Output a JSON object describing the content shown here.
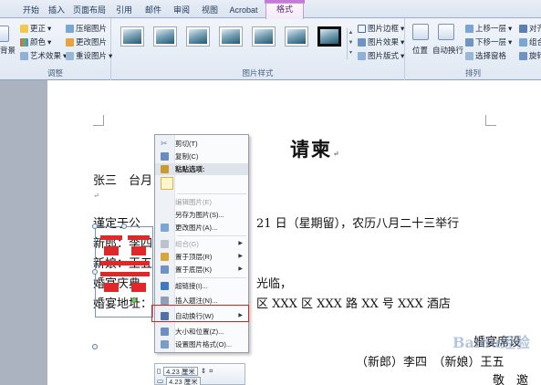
{
  "ribbon": {
    "tabs": [
      {
        "label": "开始",
        "active": false
      },
      {
        "label": "插入",
        "active": false
      },
      {
        "label": "页面布局",
        "active": false
      },
      {
        "label": "引用",
        "active": false
      },
      {
        "label": "邮件",
        "active": false
      },
      {
        "label": "审阅",
        "active": false
      },
      {
        "label": "视图",
        "active": false
      },
      {
        "label": "Acrobat",
        "active": false
      },
      {
        "label": "格式",
        "active": true
      }
    ],
    "adjust": {
      "title": "调整",
      "left_clip_label": "背景",
      "correct": "更正",
      "color": "颜色",
      "artistic": "艺术效果",
      "compress": "压缩图片",
      "change": "更改图片",
      "reset": "重设图片"
    },
    "picture_styles": {
      "title": "图片样式",
      "border": "图片边框",
      "effects": "图片效果",
      "layout": "图片版式"
    },
    "arrange": {
      "title": "排列",
      "position": "位置",
      "wrap": "自动换行",
      "bring_forward": "上移一层",
      "send_backward": "下移一层",
      "selection_pane": "选择窗格",
      "align": "对齐",
      "group": "组合",
      "rotate": "旋转"
    }
  },
  "document": {
    "title": "请柬",
    "line1": "张三　台月",
    "line2a": "谨定于公",
    "line2b": "21 日（星期留），农历八月二十三举行",
    "line3": "新郎：李四",
    "line4": "新娘：王五",
    "line5a": "婚宴庆典",
    "line5b": "光临，",
    "line6a": "婚宴地址：",
    "line6b": "区 XXX 区 XXX 路 XX 号 XXX 酒店",
    "right1": "婚宴席设",
    "right2": "（新郎）李四　（新娘）王五",
    "right3": "敬　邀",
    "watermark": "Baidu经验"
  },
  "context_menu": {
    "items": [
      {
        "label": "剪切(T)",
        "disabled": false,
        "arrow": false,
        "icon_color": "#5b7fb3"
      },
      {
        "label": "复制(C)",
        "disabled": false,
        "arrow": false,
        "icon_color": "#6a8cc0"
      },
      {
        "label": "粘贴选项:",
        "disabled": false,
        "arrow": false,
        "header": true,
        "icon_color": "#c99b2c"
      },
      {
        "label": "",
        "disabled": false,
        "arrow": false,
        "spacer": true
      },
      {
        "label": "编辑图片(E)",
        "disabled": true,
        "arrow": false
      },
      {
        "label": "另存为图片(S)...",
        "disabled": false,
        "arrow": false
      },
      {
        "label": "更改图片(A)...",
        "disabled": false,
        "arrow": false,
        "icon_color": "#7aa6d6"
      },
      {
        "label": "组合(G)",
        "disabled": true,
        "arrow": true,
        "icon_color": "#b9c2ce"
      },
      {
        "label": "置于顶层(R)",
        "disabled": false,
        "arrow": true,
        "icon_color": "#d8a53a"
      },
      {
        "label": "置于底层(K)",
        "disabled": false,
        "arrow": true,
        "icon_color": "#6f93c4"
      },
      {
        "label": "超链接(I)...",
        "disabled": false,
        "arrow": false,
        "icon_color": "#3e79c2"
      },
      {
        "label": "插入题注(N)...",
        "disabled": false,
        "arrow": false,
        "icon_color": "#8f9fb5"
      },
      {
        "label": "自动换行(W)",
        "disabled": false,
        "arrow": true,
        "icon_color": "#4f73a6"
      },
      {
        "label": "大小和位置(Z)...",
        "disabled": false,
        "arrow": false,
        "icon_color": "#6d8fbf"
      },
      {
        "label": "设置图片格式(O)...",
        "disabled": false,
        "arrow": false,
        "icon_color": "#7b9cc6"
      }
    ]
  },
  "mini_toolbar": {
    "height_value": "4.23 厘米",
    "width_value": "4.23 厘米"
  }
}
